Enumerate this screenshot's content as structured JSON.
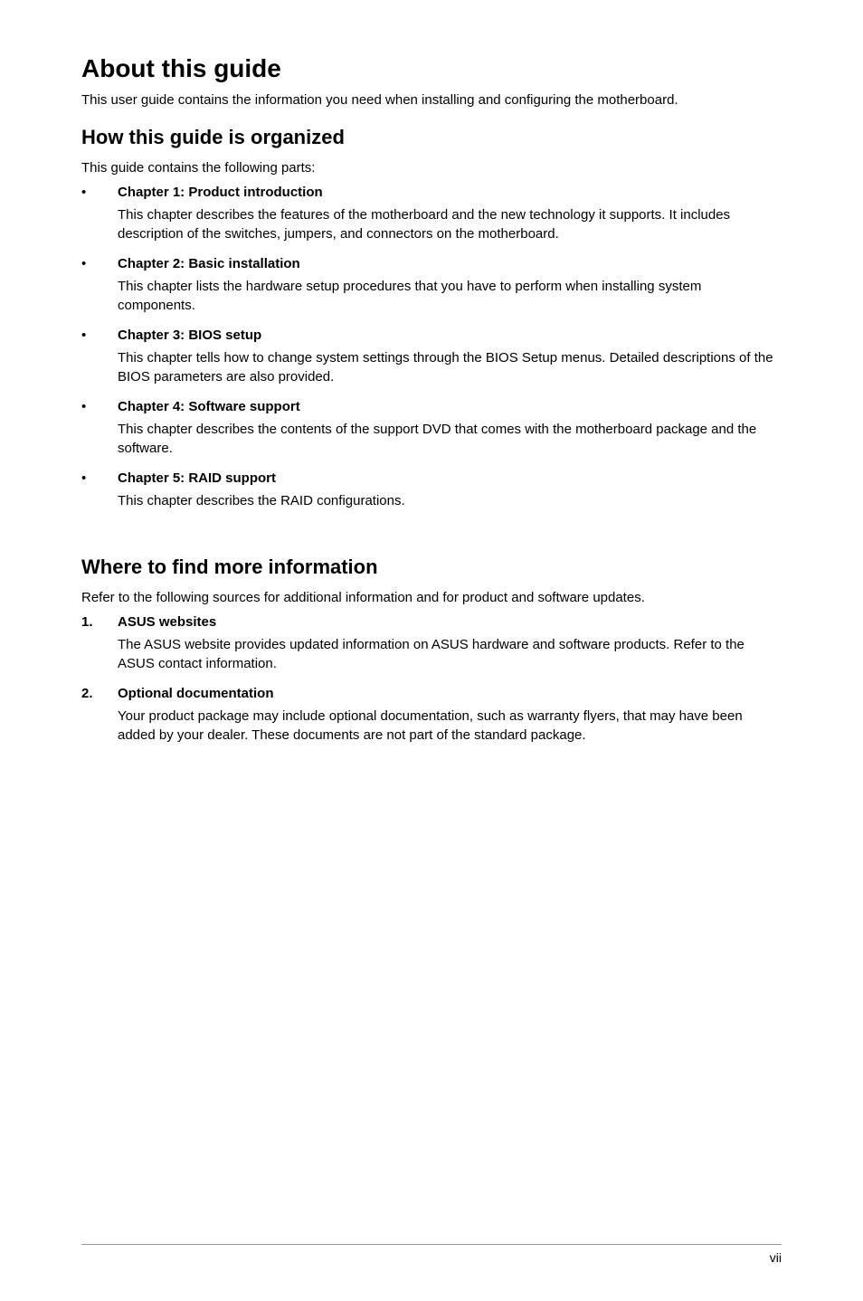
{
  "page": {
    "title": "About this guide",
    "intro": "This user guide contains the information you need when installing and configuring the motherboard.",
    "section1": {
      "heading": "How this guide is organized",
      "lead": "This guide contains the following parts:",
      "items": [
        {
          "label": "Chapter 1: Product introduction",
          "body": "This chapter describes the features of the motherboard and the new technology it supports. It includes description of the switches, jumpers, and connectors on the motherboard."
        },
        {
          "label": "Chapter 2: Basic installation",
          "body": "This chapter lists the hardware setup procedures that you have to perform when installing system components."
        },
        {
          "label": "Chapter 3: BIOS setup",
          "body": "This chapter tells how to change system settings through the BIOS Setup menus. Detailed descriptions of the BIOS parameters are also provided."
        },
        {
          "label": "Chapter 4: Software support",
          "body": "This chapter describes the contents of the support DVD that comes with the motherboard package and the software."
        },
        {
          "label": "Chapter 5: RAID support",
          "body": "This chapter describes the RAID configurations."
        }
      ]
    },
    "section2": {
      "heading": "Where to find more information",
      "lead": "Refer to the following sources for additional information and for product and software updates.",
      "items": [
        {
          "num": "1.",
          "label": "ASUS websites",
          "body": "The ASUS website provides updated information on ASUS hardware and software products. Refer to the ASUS contact information."
        },
        {
          "num": "2.",
          "label": "Optional documentation",
          "body": "Your product package may include optional documentation, such as warranty flyers, that may have been added by your dealer. These documents are not part of the standard package."
        }
      ]
    },
    "footer": {
      "pagenum": "vii"
    },
    "bullet": "•"
  }
}
